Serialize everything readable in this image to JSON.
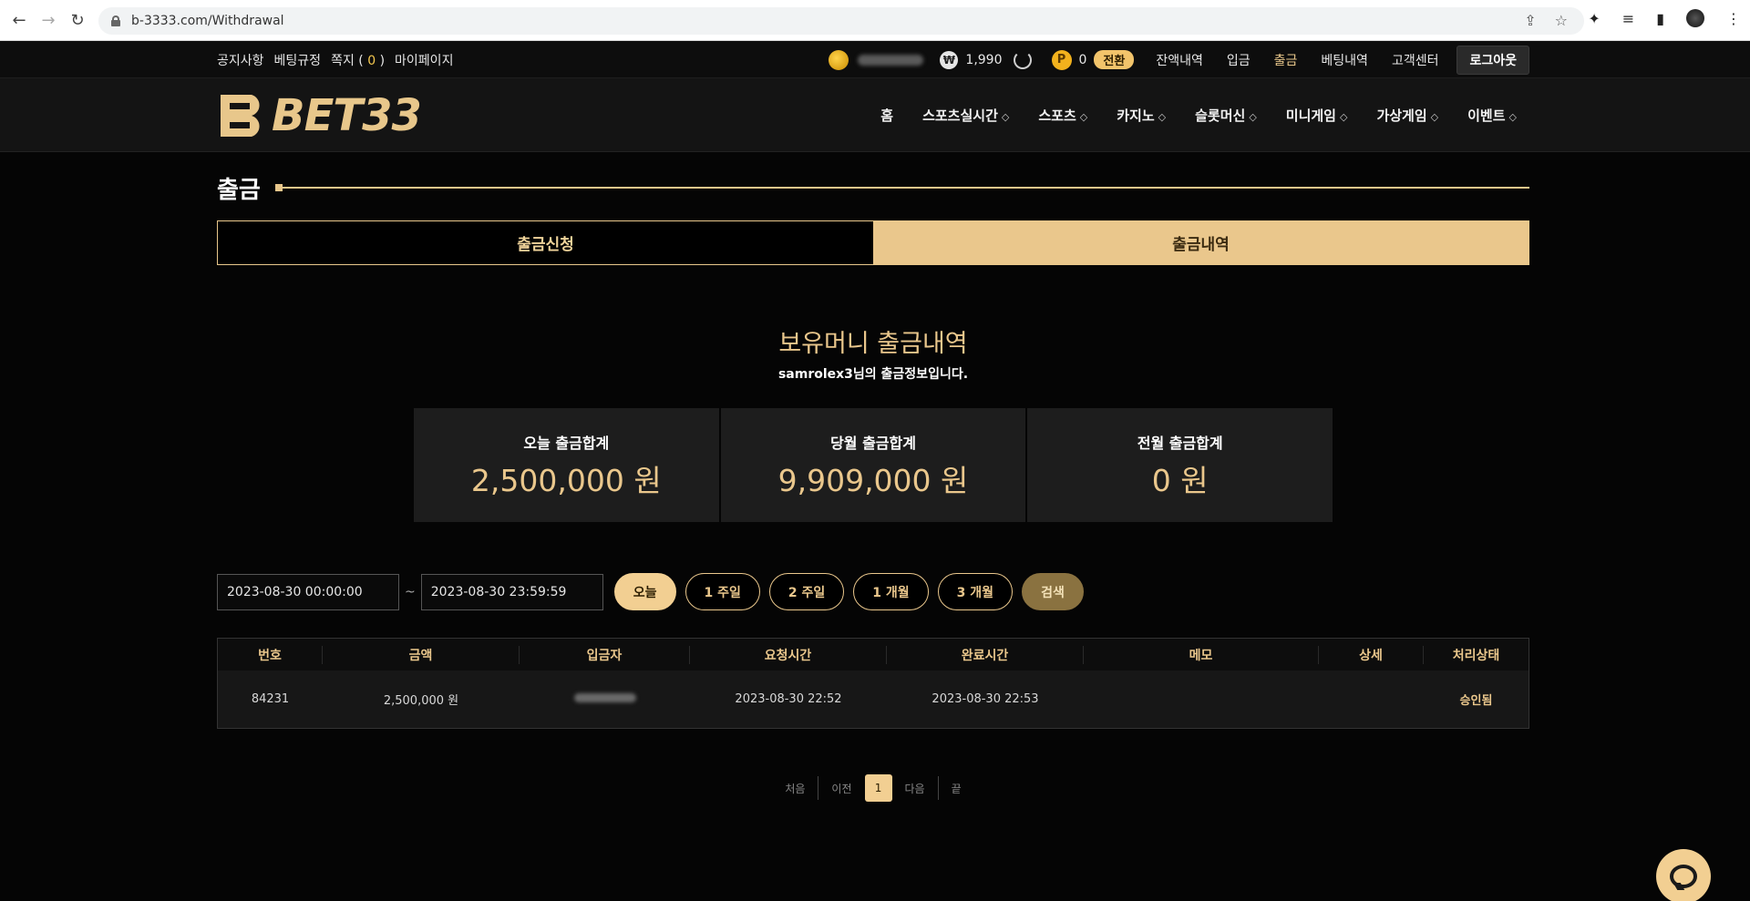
{
  "browser": {
    "url": "b-3333.com/Withdrawal"
  },
  "topbar": {
    "links": [
      "공지사항",
      "베팅규정",
      "쪽지",
      "마이페이지"
    ],
    "message_count_open": "(",
    "message_count": "0",
    "message_count_close": ")",
    "won_symbol": "₩",
    "balance": "1,990",
    "point_symbol": "P",
    "points": "0",
    "convert_label": "전환",
    "menu": [
      "잔액내역",
      "입금",
      "출금",
      "베팅내역",
      "고객센터"
    ],
    "logout_label": "로그아웃"
  },
  "header": {
    "logo_text": "BET33",
    "nav": [
      "홈",
      "스포츠실시간",
      "스포츠",
      "카지노",
      "슬롯머신",
      "미니게임",
      "가상게임",
      "이벤트"
    ]
  },
  "page": {
    "title": "출금",
    "tabs": [
      "출금신청",
      "출금내역"
    ],
    "section_title": "보유머니 출금내역",
    "section_sub": "samrolex3님의 출금정보입니다."
  },
  "summary": [
    {
      "label": "오늘 출금합계",
      "value": "2,500,000 원"
    },
    {
      "label": "당월 출금합계",
      "value": "9,909,000 원"
    },
    {
      "label": "전월 출금합계",
      "value": "0 원"
    }
  ],
  "filter": {
    "start_date": "2023-08-30 00:00:00",
    "tilde": "~",
    "end_date": "2023-08-30 23:59:59",
    "ranges": [
      "오늘",
      "1 주일",
      "2 주일",
      "1 개월",
      "3 개월"
    ],
    "search_label": "검색"
  },
  "table": {
    "headers": [
      "번호",
      "금액",
      "입금자",
      "요청시간",
      "완료시간",
      "메모",
      "상세",
      "처리상태"
    ],
    "rows": [
      {
        "no": "84231",
        "amount": "2,500,000 원",
        "requested": "2023-08-30 22:52",
        "completed": "2023-08-30 22:53",
        "memo": "",
        "detail": "",
        "status": "승인됨"
      }
    ]
  },
  "pager": {
    "first": "처음",
    "prev": "이전",
    "current": "1",
    "next": "다음",
    "last": "끝"
  },
  "colors": {
    "accent_gold": "#eac78c",
    "background": "#050505"
  }
}
